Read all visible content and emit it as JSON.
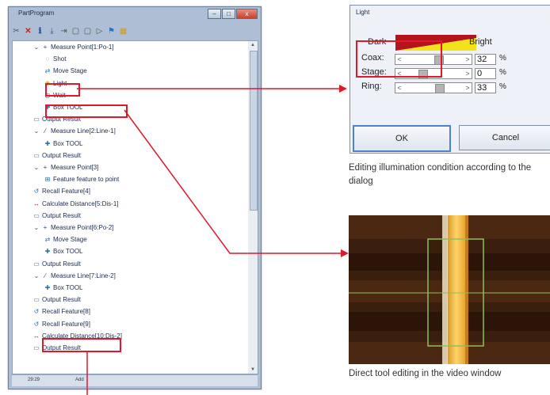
{
  "part_program": {
    "title": "PartProgram",
    "window_buttons": [
      "–",
      "□",
      "x"
    ],
    "toolbar_icons": [
      "cut-icon",
      "delete-icon",
      "info-icon",
      "insert-icon",
      "indent-icon",
      "copy-icon",
      "paste-icon",
      "paste-after-icon",
      "run-icon",
      "grid-icon"
    ],
    "tree": [
      {
        "label": "Measure Point[1:Po-1]",
        "icon": "point-icon"
      },
      {
        "label": "Shot",
        "icon": "shot-icon"
      },
      {
        "label": "Move Stage",
        "icon": "move-stage-icon"
      },
      {
        "label": "Light",
        "icon": "light-bulb-icon"
      },
      {
        "label": "Wait",
        "icon": "wait-icon"
      },
      {
        "label": "Box TOOL",
        "icon": "box-tool-icon"
      },
      {
        "label": "Output Result",
        "icon": "output-icon"
      },
      {
        "label": "Measure Line[2:Line-1]",
        "icon": "line-icon"
      },
      {
        "label": "Box TOOL",
        "icon": "box-tool-icon"
      },
      {
        "label": "Output Result",
        "icon": "output-icon"
      },
      {
        "label": "Measure Point[3]",
        "icon": "point-icon"
      },
      {
        "label": "Feature feature to point",
        "icon": "feature-icon"
      },
      {
        "label": "Recall Feature[4]",
        "icon": "recall-icon"
      },
      {
        "label": "Calculate Distance[5:Dis-1]",
        "icon": "distance-icon"
      },
      {
        "label": "Output Result",
        "icon": "output-icon"
      },
      {
        "label": "Measure Point[6:Po-2]",
        "icon": "point-icon"
      },
      {
        "label": "Move Stage",
        "icon": "move-stage-icon"
      },
      {
        "label": "Box TOOL",
        "icon": "box-tool-icon"
      },
      {
        "label": "Output Result",
        "icon": "output-icon"
      },
      {
        "label": "Measure Line[7:Line-2]",
        "icon": "line-icon"
      },
      {
        "label": "Box TOOL",
        "icon": "box-tool-icon"
      },
      {
        "label": "Output Result",
        "icon": "output-icon"
      },
      {
        "label": "Recall Feature[8]",
        "icon": "recall-icon"
      },
      {
        "label": "Recall Feature[9]",
        "icon": "recall-icon"
      },
      {
        "label": "Calculate Distance[10:Dis-2]",
        "icon": "distance-icon"
      },
      {
        "label": "Output Result",
        "icon": "output-icon"
      }
    ],
    "status": [
      "29:29",
      "Add"
    ]
  },
  "light_dialog": {
    "title": "Light",
    "dark_label": "Dark",
    "bright_label": "Bright",
    "sliders": [
      {
        "label": "Coax:",
        "value": "32",
        "unit": "%",
        "level": 0.32
      },
      {
        "label": "Stage:",
        "value": "0",
        "unit": "%",
        "level": 0.0
      },
      {
        "label": "Ring:",
        "value": "33",
        "unit": "%",
        "level": 0.33
      }
    ],
    "ok": "OK",
    "cancel": "Cancel"
  },
  "captions": {
    "dialog": "Editing illumination condition according to the dialog",
    "video": "Direct tool editing in the video window"
  },
  "colors": {
    "highlight": "#e0182a",
    "window_frame": "#aebfd5",
    "video_bright_stripe": "#f2b84a",
    "video_background": "#3a1f0e",
    "tool_box": "#8fbf5a"
  }
}
